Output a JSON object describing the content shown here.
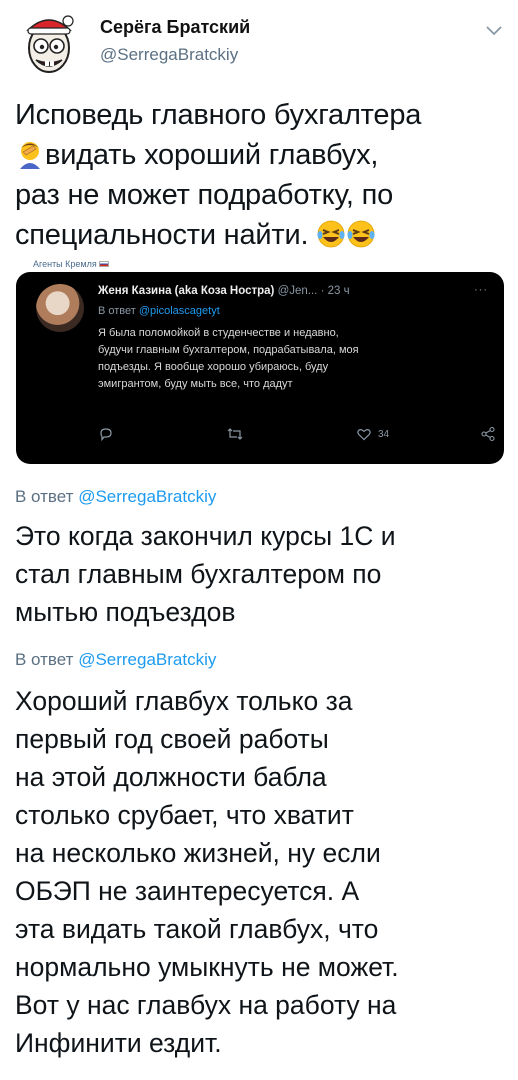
{
  "tweet": {
    "author": {
      "name": "Серёга Братский",
      "handle": "@SerregaBratckiy"
    },
    "text_lines": [
      "Исповедь главного бухгалтера",
      "видать хороший главбух,",
      "раз не может подработку, по",
      "специальности найти."
    ],
    "icons": [
      "facepalm-emoji",
      "laughing-emoji",
      "laughing-emoji"
    ]
  },
  "caption": {
    "text": "Агенты Кремля"
  },
  "embedded": {
    "name": "Женя Казина (aka Коза Ностра)",
    "handle_time": "@Jen... · 23 ч",
    "more": "···",
    "reply_prefix": "В ответ",
    "reply_handle": "@picolascagetyt",
    "body_lines": [
      "Я была поломойкой в студенчестве и недавно,",
      "будучи главным бухгалтером, подрабатывала, моя",
      "подъезды. Я вообще хорошо убираюсь, буду",
      "эмигрантом, буду мыть все, что дадут"
    ],
    "like_count": "34"
  },
  "replies": [
    {
      "label_prefix": "В ответ",
      "label_handle": "@SerregaBratckiy",
      "text_lines": [
        "Это когда закончил курсы 1С и",
        "стал главным бухгалтером по",
        "мытью подъездов"
      ]
    },
    {
      "label_prefix": "В ответ",
      "label_handle": "@SerregaBratckiy",
      "text_lines": [
        "Хороший главбух только за",
        "первый год своей работы",
        "на этой должности бабла",
        "столько срубает, что хватит",
        "на несколько жизней, ну если",
        "ОБЭП не заинтересуется. А",
        "эта видать такой главбух, что",
        "нормально умыкнуть не может.",
        "Вот у нас главбух на работу на",
        "Инфинити ездит."
      ]
    }
  ]
}
